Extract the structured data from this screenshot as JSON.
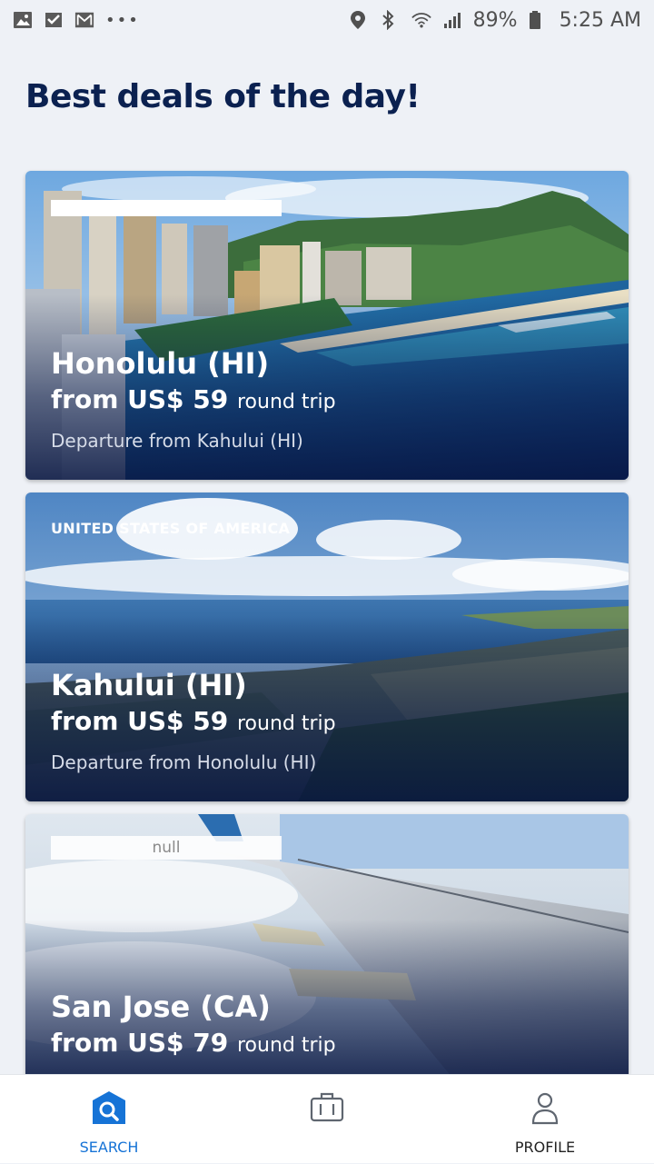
{
  "status_bar": {
    "battery": "89%",
    "time": "5:25 AM",
    "dots": "•••"
  },
  "page": {
    "title": "Best deals of the day!"
  },
  "deals": [
    {
      "city": "Honolulu (HI)",
      "price": "from US$ 59",
      "price_suffix": "round trip",
      "departure": "Departure from Kahului (HI)"
    },
    {
      "country": "UNITED STATES OF AMERICA",
      "city": "Kahului (HI)",
      "price": "from US$ 59",
      "price_suffix": "round trip",
      "departure": "Departure from Honolulu (HI)"
    },
    {
      "tag": "null",
      "city": "San Jose (CA)",
      "price": "from US$ 79",
      "price_suffix": "round trip"
    }
  ],
  "bottom_nav": {
    "search": "SEARCH",
    "profile": "PROFILE"
  },
  "colors": {
    "accent": "#1673d6",
    "title": "#0b2150"
  }
}
